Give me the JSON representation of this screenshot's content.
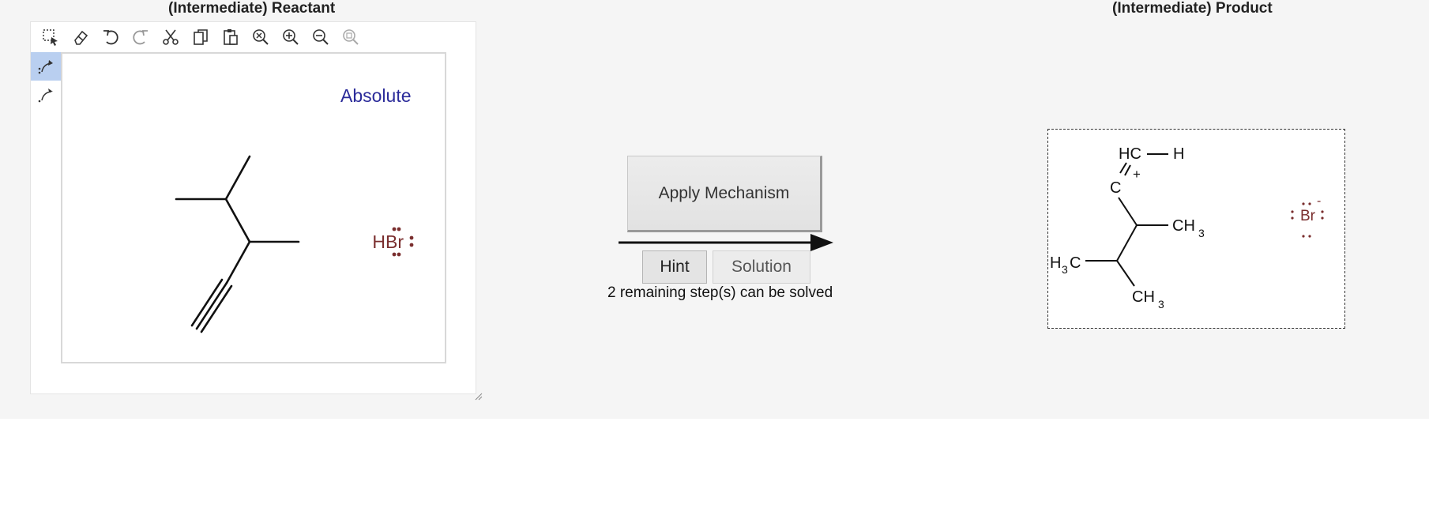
{
  "reactant_title": "(Intermediate) Reactant",
  "product_title": "(Intermediate) Product",
  "toolbar": {
    "tools": [
      {
        "name": "select-tool",
        "icon": "dashed-select-icon"
      },
      {
        "name": "erase-tool",
        "icon": "eraser-icon"
      },
      {
        "name": "undo-tool",
        "icon": "undo-icon"
      },
      {
        "name": "redo-tool",
        "icon": "redo-icon"
      },
      {
        "name": "cut-tool",
        "icon": "scissors-icon"
      },
      {
        "name": "copy-tool",
        "icon": "copy-icon"
      },
      {
        "name": "paste-tool",
        "icon": "clipboard-icon"
      },
      {
        "name": "zoom-reset-tool",
        "icon": "zoom-clear-icon"
      },
      {
        "name": "zoom-in-tool",
        "icon": "zoom-in-icon"
      },
      {
        "name": "zoom-out-tool",
        "icon": "zoom-out-icon"
      },
      {
        "name": "zoom-fit-tool",
        "icon": "zoom-fit-icon"
      }
    ]
  },
  "side_tools": [
    {
      "name": "double-arrow-tool",
      "icon": "curved-arrow-full-icon",
      "active": true
    },
    {
      "name": "single-arrow-tool",
      "icon": "curved-arrow-half-icon",
      "active": false
    }
  ],
  "reactant": {
    "stereo_label": "Absolute",
    "reagent": "HBr"
  },
  "actions": {
    "apply_label": "Apply Mechanism",
    "hint_label": "Hint",
    "solution_label": "Solution",
    "remaining_text": "2 remaining step(s) can be solved"
  },
  "product": {
    "hc": "HC",
    "h": "H",
    "c": "C",
    "plus": "+",
    "ch3_a": "CH",
    "ch3_a_sub": "3",
    "h3c_sub": "3",
    "h3c_h": "H",
    "h3c_c": "C",
    "ch3_b": "CH",
    "ch3_b_sub": "3",
    "br": "Br",
    "br_charge": "-"
  },
  "colors": {
    "stereo_label": "#2b2b9a",
    "reagent": "#7a2e2e",
    "active_tool": "#b9cff0"
  }
}
